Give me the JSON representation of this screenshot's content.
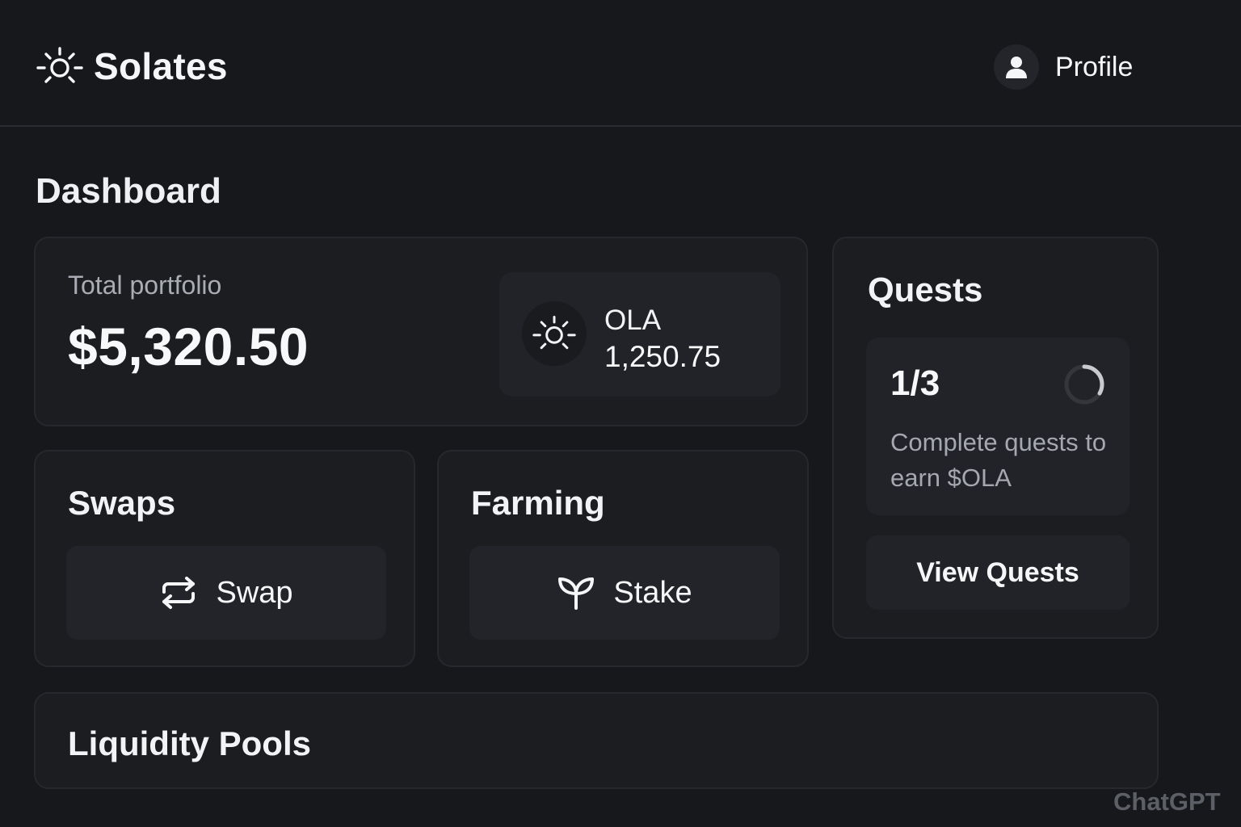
{
  "app": {
    "name": "Solates",
    "logo_icon": "sun-icon"
  },
  "header": {
    "profile_label": "Profile",
    "profile_icon": "user-icon"
  },
  "page_title": "Dashboard",
  "portfolio": {
    "label": "Total portfolio",
    "value": "$5,320.50",
    "token": {
      "icon": "sun-icon",
      "name": "OLA",
      "amount": "1,250.75"
    }
  },
  "swaps": {
    "title": "Swaps",
    "button_label": "Swap",
    "button_icon": "swap-arrows-icon"
  },
  "farming": {
    "title": "Farming",
    "button_label": "Stake",
    "button_icon": "sprout-icon"
  },
  "quests": {
    "title": "Quests",
    "progress_text": "1/3",
    "progress_fraction": 0.3333,
    "description": "Complete quests to earn $OLA",
    "button_label": "View Quests"
  },
  "liquidity_pools": {
    "title": "Liquidity Pools"
  },
  "watermark": "ChatGPT",
  "colors": {
    "background": "#17181b",
    "card": "#1c1d21",
    "inner_panel": "#222328",
    "border": "#26282d",
    "text_primary": "#f2f3f5",
    "text_muted": "#a9acb3"
  }
}
